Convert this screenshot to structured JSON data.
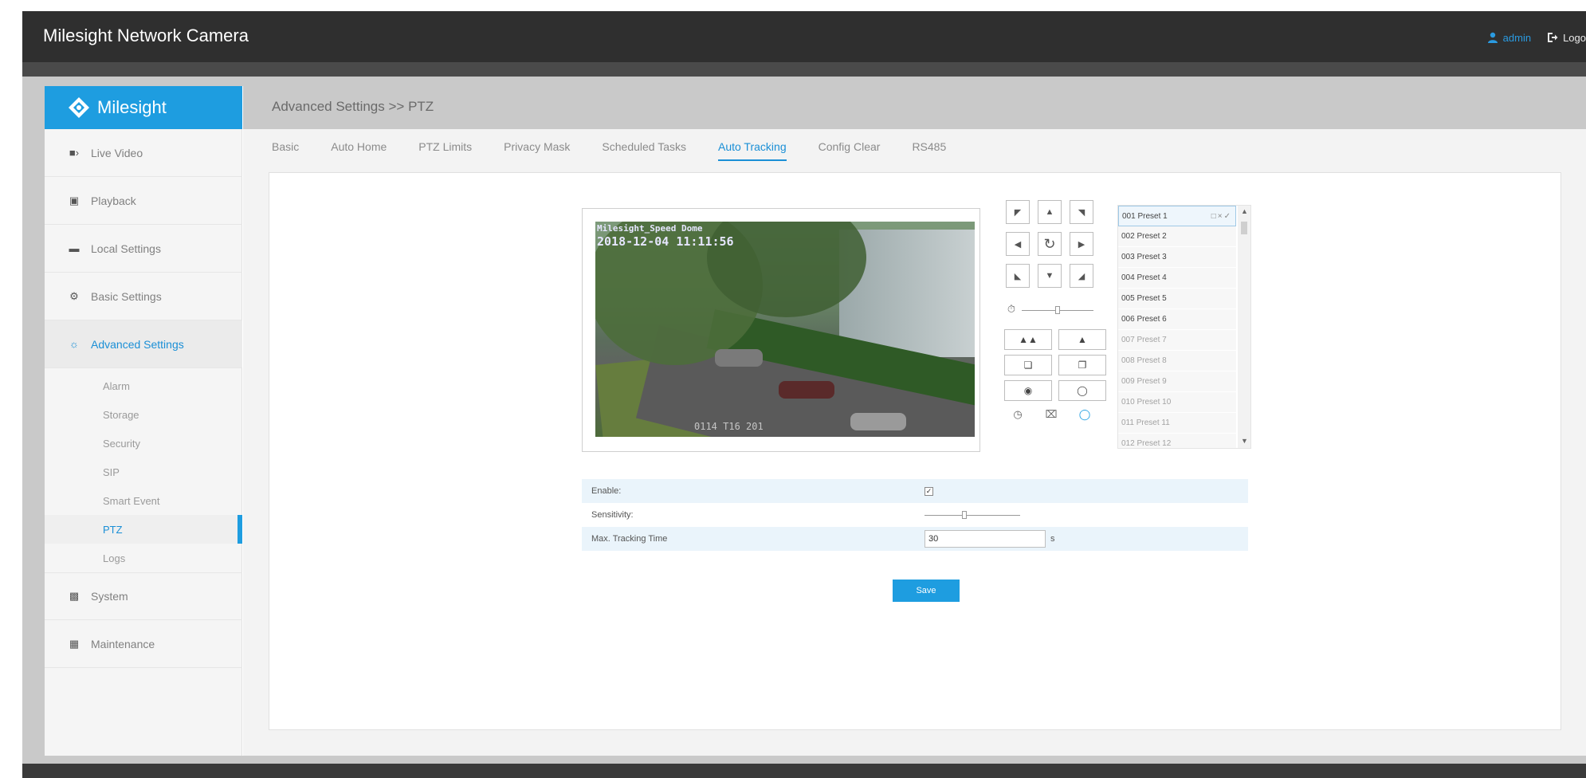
{
  "header": {
    "app_title": "Milesight Network Camera",
    "user_label": "admin",
    "logout_label": "Logo"
  },
  "sidebar": {
    "logo_text": "Milesight",
    "items": [
      {
        "label": "Live Video",
        "icon": "video-icon"
      },
      {
        "label": "Playback",
        "icon": "playback-icon"
      },
      {
        "label": "Local Settings",
        "icon": "folder-icon"
      },
      {
        "label": "Basic Settings",
        "icon": "gear-icon"
      },
      {
        "label": "Advanced Settings",
        "icon": "advanced-settings-icon"
      },
      {
        "label": "System",
        "icon": "monitor-icon"
      },
      {
        "label": "Maintenance",
        "icon": "toolbox-icon"
      }
    ],
    "sub_items": [
      "Alarm",
      "Storage",
      "Security",
      "SIP",
      "Smart Event",
      "PTZ",
      "Logs"
    ]
  },
  "main": {
    "breadcrumb": "Advanced Settings >> PTZ",
    "tabs": [
      "Basic",
      "Auto Home",
      "PTZ Limits",
      "Privacy Mask",
      "Scheduled Tasks",
      "Auto Tracking",
      "Config Clear",
      "RS485"
    ],
    "active_tab": "Auto Tracking"
  },
  "video": {
    "osd_line1": "Milesight_Speed Dome",
    "osd_line2": "2018-12-04 11:11:56",
    "osd_bottom": "0114 T16 201"
  },
  "presets": [
    "001 Preset 1",
    "002 Preset 2",
    "003 Preset 3",
    "004 Preset 4",
    "005 Preset 5",
    "006 Preset 6",
    "007 Preset 7",
    "008 Preset 8",
    "009 Preset 9",
    "010 Preset 10",
    "011 Preset 11",
    "012 Preset 12"
  ],
  "form": {
    "enable_label": "Enable:",
    "enable_checked": true,
    "sensitivity_label": "Sensitivity:",
    "sensitivity_value_fraction": 0.42,
    "max_time_label": "Max. Tracking Time",
    "max_time_value": "30",
    "max_time_unit": "s",
    "save_label": "Save"
  },
  "ptz": {
    "speed_fraction": 0.5
  },
  "colors": {
    "accent": "#1e9de0",
    "topbar": "#2f2f2f"
  }
}
